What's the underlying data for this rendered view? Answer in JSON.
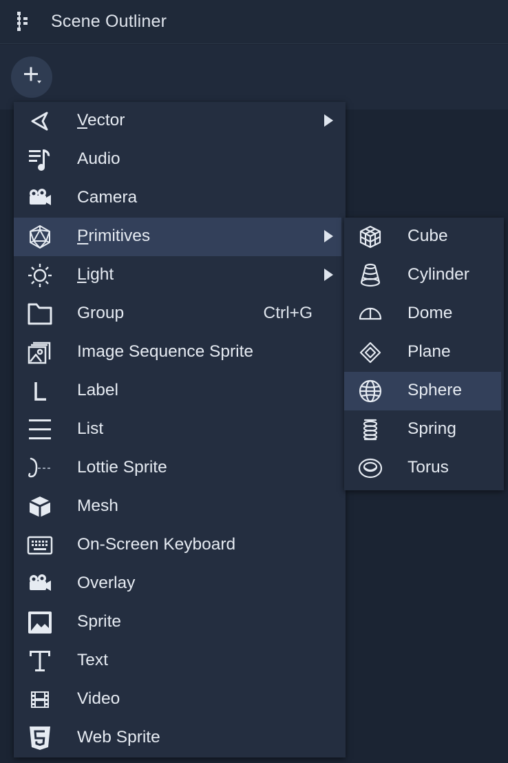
{
  "window": {
    "title": "Scene Outliner",
    "title_icon": "outliner-icon"
  },
  "toolbar": {
    "add_icon": "plus-dropdown-icon"
  },
  "menu": {
    "items": [
      {
        "label_mn": "V",
        "label_rest": "ector",
        "icon": "vector-icon",
        "submenu": true
      },
      {
        "label": "Audio",
        "icon": "audio-icon"
      },
      {
        "label": "Camera",
        "icon": "camera-icon"
      },
      {
        "label_mn": "P",
        "label_rest": "rimitives",
        "icon": "primitives-icon",
        "submenu": true,
        "highlighted": true
      },
      {
        "label_mn": "L",
        "label_rest": "ight",
        "icon": "light-icon",
        "submenu": true
      },
      {
        "label": "Group",
        "icon": "folder-icon",
        "shortcut": "Ctrl+G"
      },
      {
        "label": "Image Sequence Sprite",
        "icon": "image-sequence-icon"
      },
      {
        "label": "Label",
        "icon": "label-icon"
      },
      {
        "label": "List",
        "icon": "list-icon"
      },
      {
        "label": "Lottie Sprite",
        "icon": "lottie-icon"
      },
      {
        "label": "Mesh",
        "icon": "mesh-icon"
      },
      {
        "label": "On-Screen Keyboard",
        "icon": "keyboard-icon"
      },
      {
        "label": "Overlay",
        "icon": "overlay-icon"
      },
      {
        "label": "Sprite",
        "icon": "image-icon"
      },
      {
        "label": "Text",
        "icon": "text-icon"
      },
      {
        "label": "Video",
        "icon": "video-icon"
      },
      {
        "label": "Web Sprite",
        "icon": "html5-icon"
      }
    ]
  },
  "submenu": {
    "items": [
      {
        "label": "Cube",
        "icon": "cube-icon"
      },
      {
        "label": "Cylinder",
        "icon": "cylinder-icon"
      },
      {
        "label": "Dome",
        "icon": "dome-icon"
      },
      {
        "label": "Plane",
        "icon": "plane-icon"
      },
      {
        "label": "Sphere",
        "icon": "sphere-icon",
        "highlighted": true
      },
      {
        "label": "Spring",
        "icon": "spring-icon"
      },
      {
        "label": "Torus",
        "icon": "torus-icon"
      }
    ]
  },
  "colors": {
    "background": "#1b2433",
    "menu": "#242e40",
    "highlight": "#33405a",
    "text": "#e6ebf2"
  }
}
